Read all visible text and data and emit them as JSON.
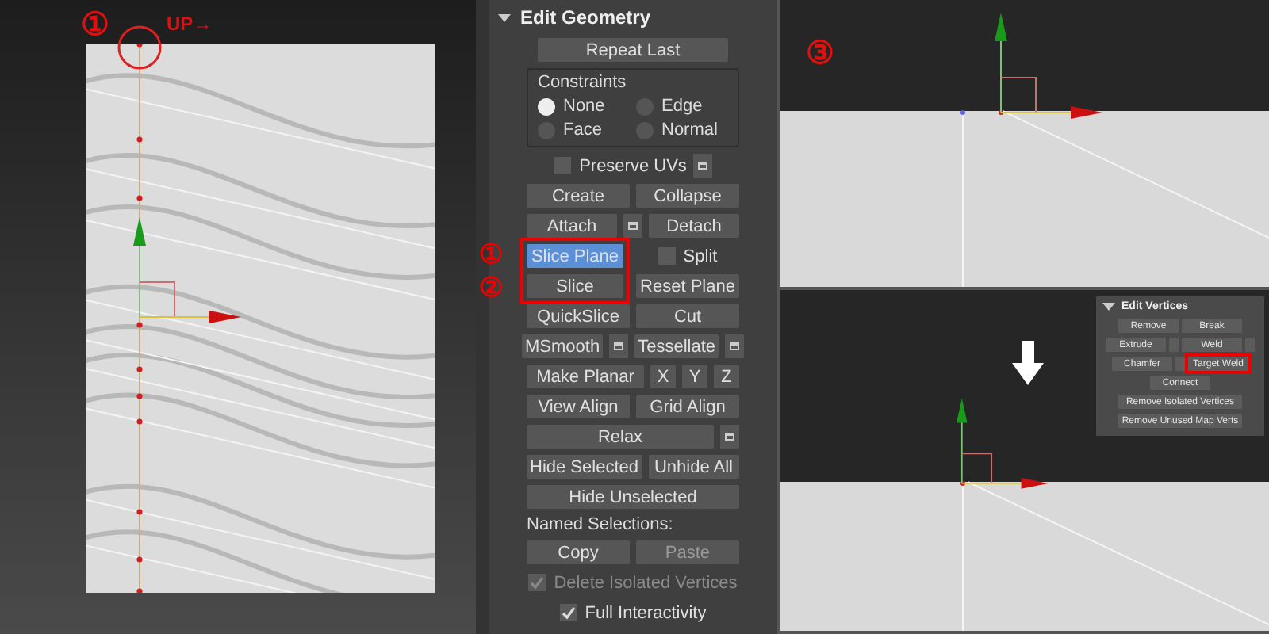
{
  "left_viewport": {
    "step_marker": "①",
    "hint": "UP→"
  },
  "edit_geometry": {
    "title": "Edit Geometry",
    "expanded": true,
    "rows": [
      {
        "kind": "buttons",
        "items": [
          {
            "kind": "button",
            "label": "Repeat Last",
            "wide": true
          }
        ]
      },
      {
        "kind": "radio_group",
        "title": "Constraints",
        "options": [
          {
            "label": "None",
            "selected": true
          },
          {
            "label": "Edge",
            "selected": false
          },
          {
            "label": "Face",
            "selected": false
          },
          {
            "label": "Normal",
            "selected": false
          }
        ]
      },
      {
        "kind": "buttons",
        "items": [
          {
            "kind": "checkbox",
            "label": "Preserve UVs",
            "checked": false,
            "disabled": false
          },
          {
            "kind": "settings"
          }
        ]
      },
      {
        "kind": "buttons",
        "items": [
          {
            "kind": "button",
            "label": "Create"
          },
          {
            "kind": "button",
            "label": "Collapse"
          }
        ]
      },
      {
        "kind": "buttons",
        "items": [
          {
            "kind": "button",
            "label": "Attach"
          },
          {
            "kind": "settings"
          },
          {
            "kind": "button",
            "label": "Detach"
          }
        ]
      },
      {
        "kind": "highlight_group",
        "markers": [
          "①",
          "②"
        ],
        "left": [
          {
            "kind": "button",
            "label": "Slice Plane",
            "active": true
          },
          {
            "kind": "button",
            "label": "Slice",
            "active": false
          }
        ],
        "right": [
          {
            "kind": "checkbox",
            "label": "Split",
            "checked": false,
            "disabled": false
          },
          {
            "kind": "button",
            "label": "Reset Plane"
          }
        ]
      },
      {
        "kind": "buttons",
        "items": [
          {
            "kind": "button",
            "label": "QuickSlice"
          },
          {
            "kind": "button",
            "label": "Cut"
          }
        ]
      },
      {
        "kind": "buttons",
        "items": [
          {
            "kind": "button",
            "label": "MSmooth"
          },
          {
            "kind": "settings"
          },
          {
            "kind": "button",
            "label": "Tessellate"
          },
          {
            "kind": "settings"
          }
        ]
      },
      {
        "kind": "buttons",
        "items": [
          {
            "kind": "button",
            "label": "Make Planar"
          },
          {
            "kind": "small",
            "label": "X"
          },
          {
            "kind": "small",
            "label": "Y"
          },
          {
            "kind": "small",
            "label": "Z"
          }
        ]
      },
      {
        "kind": "buttons",
        "items": [
          {
            "kind": "button",
            "label": "View Align"
          },
          {
            "kind": "button",
            "label": "Grid Align"
          }
        ]
      },
      {
        "kind": "buttons",
        "items": [
          {
            "kind": "button",
            "label": "Relax"
          },
          {
            "kind": "settings"
          }
        ]
      },
      {
        "kind": "buttons",
        "items": [
          {
            "kind": "button",
            "label": "Hide Selected"
          },
          {
            "kind": "button",
            "label": "Unhide All"
          }
        ]
      },
      {
        "kind": "buttons",
        "items": [
          {
            "kind": "button",
            "label": "Hide Unselected"
          }
        ]
      },
      {
        "kind": "label",
        "text": "Named Selections:"
      },
      {
        "kind": "buttons",
        "items": [
          {
            "kind": "button",
            "label": "Copy"
          },
          {
            "kind": "button",
            "label": "Paste",
            "disabled": true
          }
        ]
      },
      {
        "kind": "buttons",
        "items": [
          {
            "kind": "checkbox",
            "label": "Delete Isolated Vertices",
            "checked": true,
            "disabled": true
          }
        ]
      },
      {
        "kind": "buttons",
        "items": [
          {
            "kind": "checkbox",
            "label": "Full Interactivity",
            "checked": true,
            "disabled": false
          }
        ]
      }
    ]
  },
  "top_right_viewport": {
    "step_marker": "③"
  },
  "edit_vertices": {
    "title": "Edit Vertices",
    "expanded": true,
    "rows": [
      [
        {
          "kind": "button",
          "label": "Remove"
        },
        {
          "kind": "button",
          "label": "Break"
        }
      ],
      [
        {
          "kind": "button",
          "label": "Extrude"
        },
        {
          "kind": "settings"
        },
        {
          "kind": "button",
          "label": "Weld"
        },
        {
          "kind": "settings"
        }
      ],
      [
        {
          "kind": "button",
          "label": "Chamfer"
        },
        {
          "kind": "settings"
        },
        {
          "kind": "button",
          "label": "Target Weld",
          "highlighted": true
        }
      ],
      [
        {
          "kind": "button",
          "label": "Connect"
        }
      ],
      [
        {
          "kind": "button",
          "label": "Remove Isolated Vertices",
          "wide": true
        }
      ],
      [
        {
          "kind": "button",
          "label": "Remove Unused Map Verts",
          "wide": true
        }
      ]
    ]
  }
}
